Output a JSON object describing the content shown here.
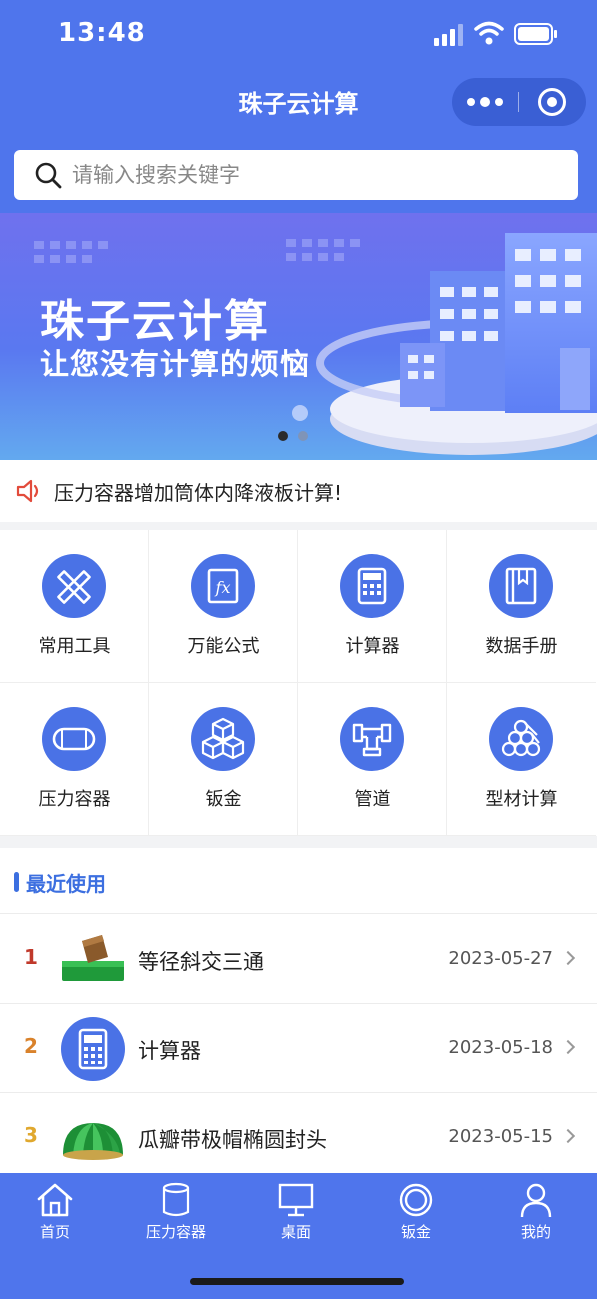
{
  "status_bar": {
    "time": "13:48"
  },
  "nav": {
    "title": "珠子云计算",
    "more_icon": "more-dots-icon",
    "close_icon": "target-close-icon"
  },
  "search": {
    "placeholder": "请输入搜索关键字",
    "value": ""
  },
  "banner": {
    "title": "珠子云计算",
    "subtitle": "让您没有计算的烦恼",
    "page_count": 2,
    "active_page": 1
  },
  "notice": {
    "icon": "speaker-icon",
    "text": "压力容器增加筒体内降液板计算!"
  },
  "grid": {
    "items": [
      {
        "label": "常用工具",
        "icon": "pencil-ruler-icon"
      },
      {
        "label": "万能公式",
        "icon": "function-icon"
      },
      {
        "label": "计算器",
        "icon": "calculator-icon"
      },
      {
        "label": "数据手册",
        "icon": "book-icon"
      },
      {
        "label": "压力容器",
        "icon": "vessel-icon"
      },
      {
        "label": "钣金",
        "icon": "cubes-icon"
      },
      {
        "label": "管道",
        "icon": "pipe-icon"
      },
      {
        "label": "型材计算",
        "icon": "profile-bars-icon"
      }
    ]
  },
  "recent": {
    "title": "最近使用",
    "items": [
      {
        "rank": "1",
        "name": "等径斜交三通",
        "date": "2023-05-27",
        "rank_color": "#c0392b"
      },
      {
        "rank": "2",
        "name": "计算器",
        "date": "2023-05-18",
        "rank_color": "#d9822b"
      },
      {
        "rank": "3",
        "name": "瓜瓣带极帽椭圆封头",
        "date": "2023-05-15",
        "rank_color": "#e0a82e"
      }
    ]
  },
  "tabbar": {
    "items": [
      {
        "label": "首页",
        "icon": "home-icon"
      },
      {
        "label": "压力容器",
        "icon": "tank-icon"
      },
      {
        "label": "桌面",
        "icon": "monitor-icon"
      },
      {
        "label": "钣金",
        "icon": "ring-icon"
      },
      {
        "label": "我的",
        "icon": "user-icon"
      }
    ]
  },
  "colors": {
    "primary": "#4f75ec",
    "accent": "#3c6fe0"
  }
}
